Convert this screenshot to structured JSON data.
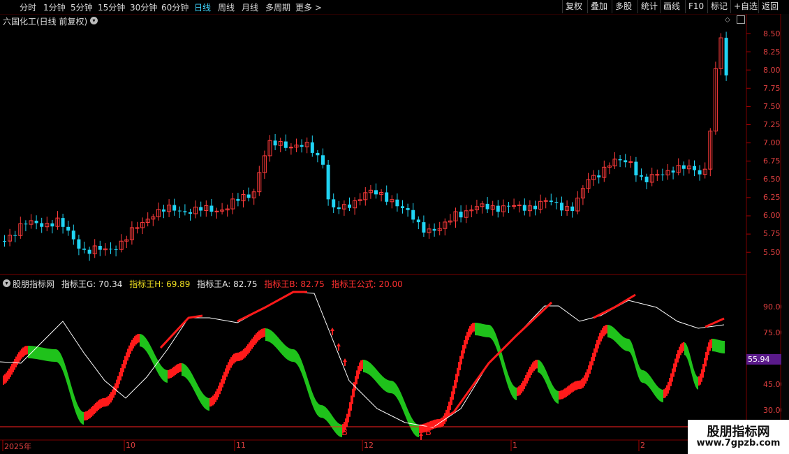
{
  "toolbar": {
    "periods": [
      "分时",
      "1分钟",
      "5分钟",
      "15分钟",
      "30分钟",
      "60分钟",
      "日线",
      "周线",
      "月线",
      "多周期",
      "更多 >"
    ],
    "active_period": "日线",
    "right_buttons": [
      "复权",
      "叠加",
      "多股",
      "统计",
      "画线",
      "F10",
      "标记",
      "+自选",
      "返回"
    ]
  },
  "stock": {
    "title": "六国化工(日线 前复权)"
  },
  "price_axis": [
    "8.50",
    "8.25",
    "8.00",
    "7.75",
    "7.50",
    "7.25",
    "7.00",
    "6.75",
    "6.50",
    "6.25",
    "6.00",
    "5.75",
    "5.50"
  ],
  "indicator": {
    "name": "股朋指标网",
    "g_label": "指标王G: 70.34",
    "h_label": "指标王H: 69.89",
    "a_label": "指标王A: 82.75",
    "b_label": "指标王B: 82.75",
    "formula_label": "指标王公式: 20.00",
    "current_value": "55.94",
    "axis": [
      "90.00",
      "75.00",
      "45.00",
      "30.00"
    ],
    "signal_label": "B"
  },
  "time_axis": [
    "2025年",
    "10",
    "11",
    "12",
    "1",
    "2"
  ],
  "watermark": {
    "title": "股朋指标网",
    "url": "www.7gpzb.com"
  },
  "colors": {
    "up": "#ff2020",
    "down": "#20d0f0",
    "green": "#22c01e",
    "red": "#ff1a1a",
    "white": "#ffffff"
  }
}
